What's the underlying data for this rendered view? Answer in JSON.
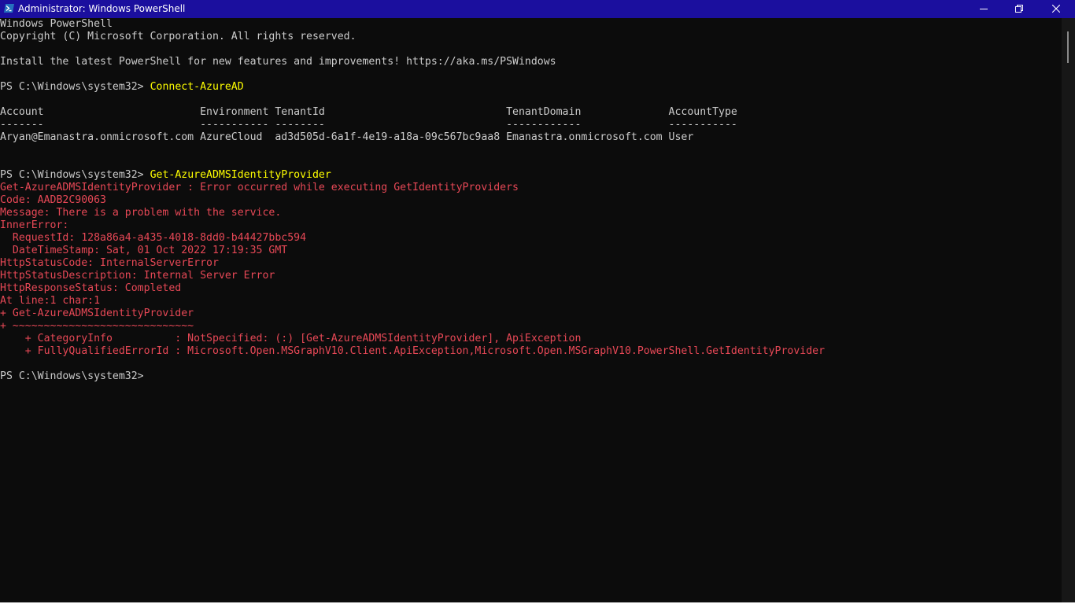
{
  "window": {
    "title": "Administrator: Windows PowerShell",
    "icon": "powershell-icon",
    "controls": {
      "minimize": "minimize-icon",
      "maximize": "restore-icon",
      "close": "close-icon"
    }
  },
  "colors": {
    "titlebar": "#1b0f9e",
    "background": "#0c0c0c",
    "output_text": "#cccccc",
    "command_text": "#ffff00",
    "error_text": "#e74856"
  },
  "console": {
    "lines": [
      {
        "type": "out",
        "text": "Windows PowerShell"
      },
      {
        "type": "out",
        "text": "Copyright (C) Microsoft Corporation. All rights reserved."
      },
      {
        "type": "out",
        "text": ""
      },
      {
        "type": "out",
        "text": "Install the latest PowerShell for new features and improvements! https://aka.ms/PSWindows"
      },
      {
        "type": "out",
        "text": ""
      },
      {
        "type": "prompt",
        "prompt": "PS C:\\Windows\\system32> ",
        "command": "Connect-AzureAD"
      },
      {
        "type": "out",
        "text": ""
      },
      {
        "type": "out",
        "text": "Account                         Environment TenantId                             TenantDomain              AccountType"
      },
      {
        "type": "out",
        "text": "-------                         ----------- --------                             ------------              -----------"
      },
      {
        "type": "out",
        "text": "Aryan@Emanastra.onmicrosoft.com AzureCloud  ad3d505d-6a1f-4e19-a18a-09c567bc9aa8 Emanastra.onmicrosoft.com User"
      },
      {
        "type": "out",
        "text": ""
      },
      {
        "type": "out",
        "text": ""
      },
      {
        "type": "prompt",
        "prompt": "PS C:\\Windows\\system32> ",
        "command": "Get-AzureADMSIdentityProvider"
      },
      {
        "type": "err",
        "text": "Get-AzureADMSIdentityProvider : Error occurred while executing GetIdentityProviders"
      },
      {
        "type": "err",
        "text": "Code: AADB2C90063"
      },
      {
        "type": "err",
        "text": "Message: There is a problem with the service."
      },
      {
        "type": "err",
        "text": "InnerError:"
      },
      {
        "type": "err",
        "text": "  RequestId: 128a86a4-a435-4018-8dd0-b44427bbc594"
      },
      {
        "type": "err",
        "text": "  DateTimeStamp: Sat, 01 Oct 2022 17:19:35 GMT"
      },
      {
        "type": "err",
        "text": "HttpStatusCode: InternalServerError"
      },
      {
        "type": "err",
        "text": "HttpStatusDescription: Internal Server Error"
      },
      {
        "type": "err",
        "text": "HttpResponseStatus: Completed"
      },
      {
        "type": "err",
        "text": "At line:1 char:1"
      },
      {
        "type": "err",
        "text": "+ Get-AzureADMSIdentityProvider"
      },
      {
        "type": "err",
        "text": "+ ~~~~~~~~~~~~~~~~~~~~~~~~~~~~~"
      },
      {
        "type": "err",
        "text": "    + CategoryInfo          : NotSpecified: (:) [Get-AzureADMSIdentityProvider], ApiException"
      },
      {
        "type": "err",
        "text": "    + FullyQualifiedErrorId : Microsoft.Open.MSGraphV10.Client.ApiException,Microsoft.Open.MSGraphV10.PowerShell.GetIdentityProvider"
      },
      {
        "type": "out",
        "text": ""
      },
      {
        "type": "prompt",
        "prompt": "PS C:\\Windows\\system32> ",
        "command": ""
      }
    ]
  }
}
